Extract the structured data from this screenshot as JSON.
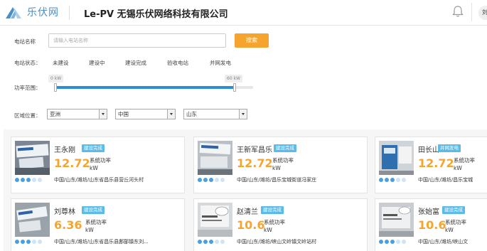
{
  "header": {
    "logo_text": "乐伏网",
    "company": "Le-PV 无锡乐伏网络科技有限公司",
    "user_short": "刘"
  },
  "search": {
    "label": "电站名称",
    "placeholder": "请输入电站名称",
    "button": "搜索"
  },
  "status_filter": {
    "label": "电站状态：",
    "options": [
      "未建设",
      "建设中",
      "建设完成",
      "验收电站",
      "并网发电"
    ]
  },
  "power_filter": {
    "label": "功率范围：",
    "min_label": "0 kW",
    "max_label": "60 kW",
    "min_value": 0,
    "max_value": 60
  },
  "region_filter": {
    "label": "区域位置：",
    "continent": "亚洲",
    "country": "中国",
    "province": "山东"
  },
  "colors": {
    "accent_orange": "#f5a52f",
    "accent_blue": "#2b8fd6",
    "badge_blue": "#5bbbe8"
  },
  "cards": [
    {
      "owner": "王永刚",
      "badge": "建设完成",
      "power": "12.72",
      "power_label": "系统功率",
      "unit": "kW",
      "address": "中国/山东/潍坊/山东省昌乐县营丘河头村"
    },
    {
      "owner": "王新军昌乐",
      "badge": "建设完成",
      "power": "12.72",
      "power_label": "系统功率",
      "unit": "kW",
      "address": "中国/山东/潍坊/昌乐宝城街道冯家庄"
    },
    {
      "owner": "田长山",
      "badge": "并网发电",
      "power": "12.72",
      "power_label": "系统功率",
      "unit": "kW",
      "address": "中国/山东/潍坊/昌乐宝城"
    },
    {
      "owner": "刘尊林",
      "badge": "建设完成",
      "power": "6.36",
      "power_label": "系统功率",
      "unit": "kW",
      "address": "中国/山东/潍坊/山东省昌乐县鄌郚镇东刘..."
    },
    {
      "owner": "赵清兰",
      "badge": "建设完成",
      "power": "10.6",
      "power_label": "系统功率",
      "unit": "kW",
      "address": "中国/山东/潍坊/峡山文岭镇文岭站村"
    },
    {
      "owner": "张始富",
      "badge": "建设完成",
      "power": "10.6",
      "power_label": "系统功率",
      "unit": "kW",
      "address": "中国/山东/潍坊/峡山文"
    }
  ]
}
